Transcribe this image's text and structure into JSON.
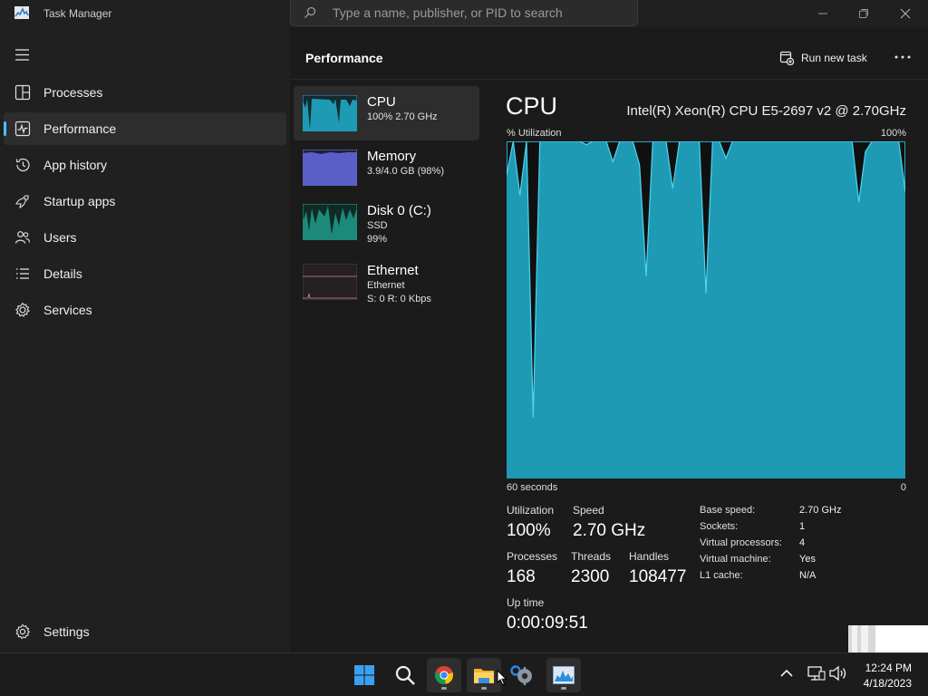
{
  "window": {
    "title": "Task Manager",
    "search_placeholder": "Type a name, publisher, or PID to search"
  },
  "sidebar": {
    "items": [
      {
        "label": "Processes",
        "icon": "processes-icon"
      },
      {
        "label": "Performance",
        "icon": "performance-icon",
        "active": true
      },
      {
        "label": "App history",
        "icon": "history-icon"
      },
      {
        "label": "Startup apps",
        "icon": "startup-icon"
      },
      {
        "label": "Users",
        "icon": "users-icon"
      },
      {
        "label": "Details",
        "icon": "details-icon"
      },
      {
        "label": "Services",
        "icon": "services-icon"
      }
    ],
    "settings_label": "Settings"
  },
  "header": {
    "title": "Performance",
    "run_new_task_label": "Run new task"
  },
  "resources": [
    {
      "name": "CPU",
      "sub1": "100% 2.70 GHz",
      "sub2": "",
      "sub3": ""
    },
    {
      "name": "Memory",
      "sub1": "3.9/4.0 GB (98%)",
      "sub2": "",
      "sub3": ""
    },
    {
      "name": "Disk 0 (C:)",
      "sub1": "SSD",
      "sub2": "99%",
      "sub3": ""
    },
    {
      "name": "Ethernet",
      "sub1": "Ethernet",
      "sub2": "S: 0 R: 0 Kbps",
      "sub3": ""
    }
  ],
  "detail": {
    "heading": "CPU",
    "model": "Intel(R) Xeon(R) CPU E5-2697 v2 @ 2.70GHz",
    "chart_top_left": "% Utilization",
    "chart_top_right": "100%",
    "chart_bottom_left": "60 seconds",
    "chart_bottom_right": "0",
    "stats": {
      "utilization_label": "Utilization",
      "utilization_value": "100%",
      "speed_label": "Speed",
      "speed_value": "2.70 GHz",
      "processes_label": "Processes",
      "processes_value": "168",
      "threads_label": "Threads",
      "threads_value": "2300",
      "handles_label": "Handles",
      "handles_value": "108477",
      "uptime_label": "Up time",
      "uptime_value": "0:00:09:51"
    },
    "specs": [
      {
        "label": "Base speed:",
        "value": "2.70 GHz"
      },
      {
        "label": "Sockets:",
        "value": "1"
      },
      {
        "label": "Virtual processors:",
        "value": "4"
      },
      {
        "label": "Virtual machine:",
        "value": "Yes"
      },
      {
        "label": "L1 cache:",
        "value": "N/A"
      }
    ]
  },
  "chart_data": {
    "type": "area",
    "xlabel": "60 seconds",
    "ylabel": "% Utilization",
    "x": [
      60,
      59,
      58,
      57,
      56,
      55,
      54,
      53,
      52,
      51,
      50,
      49,
      48,
      47,
      46,
      45,
      44,
      43,
      42,
      41,
      40,
      39,
      38,
      37,
      36,
      35,
      34,
      33,
      32,
      31,
      30,
      29,
      28,
      27,
      26,
      25,
      24,
      23,
      22,
      21,
      20,
      19,
      18,
      17,
      16,
      15,
      14,
      13,
      12,
      11,
      10,
      9,
      8,
      7,
      6,
      5,
      4,
      3,
      2,
      1,
      0
    ],
    "values": [
      90,
      100,
      84,
      100,
      18,
      100,
      100,
      100,
      100,
      100,
      100,
      100,
      99,
      100,
      100,
      100,
      94,
      100,
      100,
      100,
      93,
      60,
      100,
      100,
      100,
      86,
      100,
      100,
      100,
      100,
      55,
      100,
      100,
      95,
      100,
      100,
      100,
      100,
      100,
      100,
      100,
      100,
      100,
      100,
      100,
      100,
      100,
      100,
      100,
      100,
      100,
      100,
      100,
      82,
      97,
      100,
      100,
      100,
      100,
      100,
      85
    ],
    "ylim": [
      0,
      100
    ],
    "xlim": [
      60,
      0
    ],
    "grid": false,
    "fill_color": "#1f9ab5",
    "line_color": "#4fd4ef"
  },
  "taskbar": {
    "clock_time": "12:24 PM",
    "clock_date": "4/18/2023",
    "apps": [
      "start-icon",
      "search-icon",
      "chrome-icon",
      "file-explorer-icon",
      "settings-icon",
      "task-manager-icon"
    ]
  },
  "colors": {
    "accent": "#4cc2ff",
    "cpu_fill": "#1f9ab5",
    "memory_fill": "#5a5fc8",
    "disk_fill": "#1c8a7a",
    "ethernet_line": "#d4849a"
  }
}
